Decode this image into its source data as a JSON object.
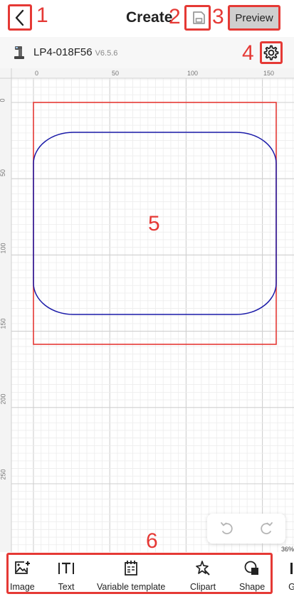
{
  "header": {
    "title": "Create",
    "preview_label": "Preview"
  },
  "device": {
    "name": "LP4-018F56",
    "version": "V6.5.6"
  },
  "ruler": {
    "h_ticks": [
      "0",
      "50",
      "100",
      "150"
    ],
    "v_ticks": [
      "0",
      "50",
      "100",
      "150",
      "200",
      "250"
    ]
  },
  "zoom": "36%",
  "toolbar": {
    "items": [
      {
        "label": "Image",
        "icon": "image-add-icon"
      },
      {
        "label": "Text",
        "icon": "text-icon"
      },
      {
        "label": "Variable template",
        "icon": "variable-template-icon"
      },
      {
        "label": "Clipart",
        "icon": "clipart-icon"
      },
      {
        "label": "Shape",
        "icon": "shape-icon"
      },
      {
        "label": "G",
        "icon": "partial-icon"
      }
    ]
  },
  "annotations": [
    "1",
    "2",
    "3",
    "4",
    "5",
    "6"
  ],
  "colors": {
    "annotation": "#e53935",
    "label_border": "#e53935",
    "shape_stroke": "#1a1aa8",
    "preview_bg": "#cfcfcf"
  }
}
